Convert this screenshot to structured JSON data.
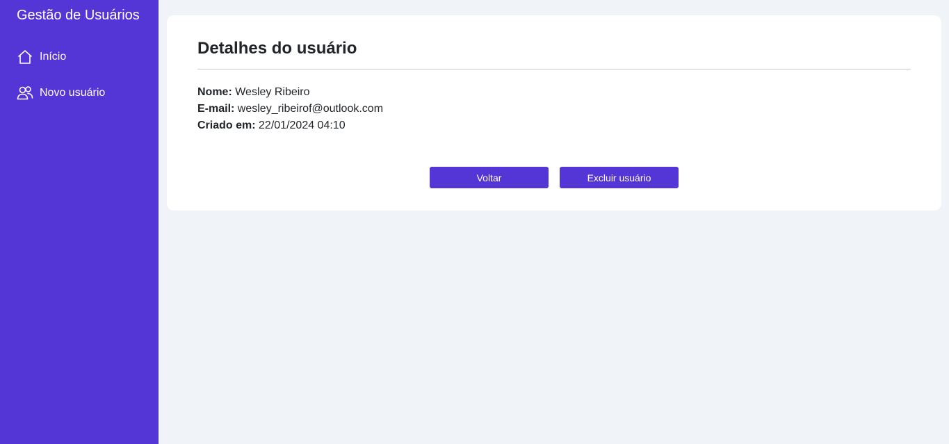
{
  "sidebar": {
    "brand": "Gestão de Usuários",
    "items": [
      {
        "label": "Início",
        "icon": "home-icon"
      },
      {
        "label": "Novo usuário",
        "icon": "users-icon"
      }
    ]
  },
  "card": {
    "title": "Detalhes do usuário",
    "fields": [
      {
        "label": "Nome:",
        "value": "Wesley Ribeiro"
      },
      {
        "label": "E-mail:",
        "value": "wesley_ribeirof@outlook.com"
      },
      {
        "label": "Criado em:",
        "value": "22/01/2024 04:10"
      }
    ],
    "back_label": "Voltar",
    "delete_label": "Excluir usuário"
  },
  "colors": {
    "primary": "#5435d6",
    "background": "#f0f3f7",
    "card": "#ffffff",
    "text": "#212529"
  }
}
